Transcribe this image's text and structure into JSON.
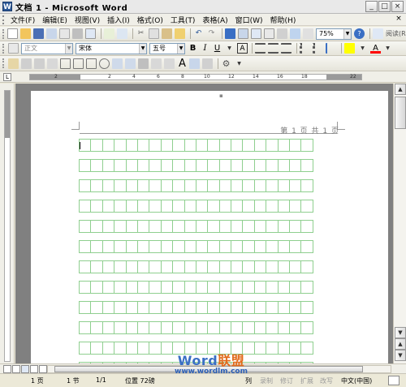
{
  "window": {
    "title": "文档 1 - Microsoft Word",
    "app_icon": "W",
    "controls": {
      "minimize": "_",
      "maximize": "□",
      "close": "×"
    }
  },
  "menubar": {
    "items": [
      "文件(F)",
      "编辑(E)",
      "视图(V)",
      "插入(I)",
      "格式(O)",
      "工具(T)",
      "表格(A)",
      "窗口(W)",
      "帮助(H)"
    ],
    "close_doc": "×"
  },
  "standard_toolbar": {
    "zoom": "75%",
    "reading_label": "阅读(R)"
  },
  "formatting_toolbar": {
    "style": "正文",
    "font": "宋体",
    "size": "五号",
    "bold": "B",
    "italic": "I",
    "underline": "U",
    "char_border": "A",
    "highlight_color": "#ffff00",
    "font_color": "#ff0000",
    "font_color_label": "A"
  },
  "ruler": {
    "labels": [
      "2",
      "2",
      "4",
      "6",
      "8",
      "10",
      "12",
      "14",
      "16",
      "18",
      "22"
    ]
  },
  "document": {
    "header_text": "第 1 页 共 1 页",
    "grid_line_color": "#8fcf8f"
  },
  "status": {
    "page": "1 页",
    "section": "1 节",
    "page_of": "1/1",
    "position": "位置 72磅",
    "column": "列",
    "rec": "录制",
    "trk": "修订",
    "ext": "扩展",
    "ovr": "改写",
    "language": "中文(中国)"
  },
  "watermark": {
    "logo_latin": "Word",
    "logo_cn": "联盟",
    "url": "www.wordlm.com"
  }
}
